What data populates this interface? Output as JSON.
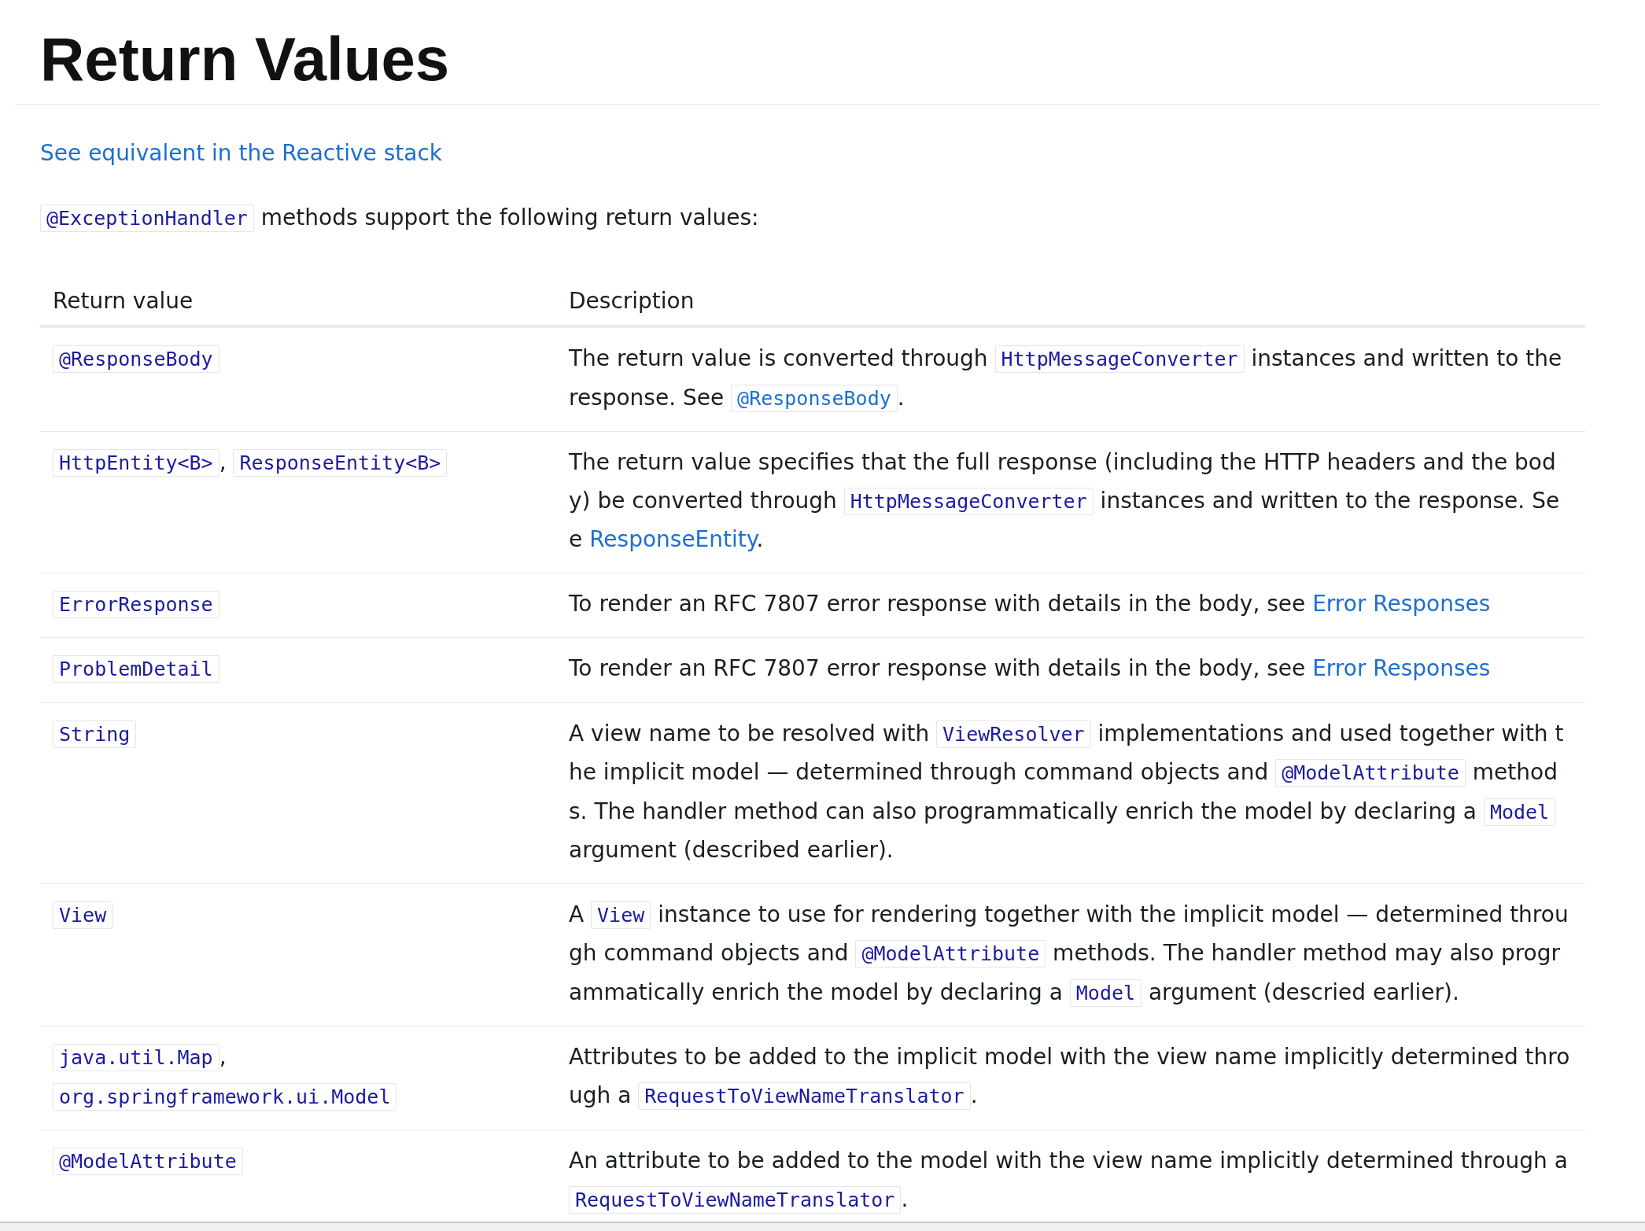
{
  "title": "Return Values",
  "reactive_link": "See equivalent in the Reactive stack",
  "intro": [
    {
      "kind": "code",
      "text": "@ExceptionHandler"
    },
    {
      "kind": "text",
      "text": " methods support the following return values:"
    }
  ],
  "table": {
    "columns": [
      "Return value",
      "Description"
    ],
    "rows": [
      {
        "return_value": [
          {
            "kind": "code",
            "text": "@ResponseBody"
          }
        ],
        "description": [
          {
            "kind": "text",
            "text": "The return value is converted through "
          },
          {
            "kind": "code",
            "text": "HttpMessageConverter"
          },
          {
            "kind": "text",
            "text": " instances and written to the response. See "
          },
          {
            "kind": "code_link",
            "text": "@ResponseBody"
          },
          {
            "kind": "text",
            "text": "."
          }
        ]
      },
      {
        "return_value": [
          {
            "kind": "code",
            "text": "HttpEntity<B>"
          },
          {
            "kind": "text",
            "text": ", "
          },
          {
            "kind": "code",
            "text": "ResponseEntity<B>"
          }
        ],
        "description": [
          {
            "kind": "text",
            "text": "The return value specifies that the full response (including the HTTP headers and the body) be converted through "
          },
          {
            "kind": "code",
            "text": "HttpMessageConverter"
          },
          {
            "kind": "text",
            "text": " instances and written to the response. See "
          },
          {
            "kind": "link",
            "text": "ResponseEntity"
          },
          {
            "kind": "text",
            "text": "."
          }
        ]
      },
      {
        "return_value": [
          {
            "kind": "code",
            "text": "ErrorResponse"
          }
        ],
        "description": [
          {
            "kind": "text",
            "text": "To render an RFC 7807 error response with details in the body, see "
          },
          {
            "kind": "link",
            "text": "Error Responses"
          }
        ]
      },
      {
        "return_value": [
          {
            "kind": "code",
            "text": "ProblemDetail"
          }
        ],
        "description": [
          {
            "kind": "text",
            "text": "To render an RFC 7807 error response with details in the body, see "
          },
          {
            "kind": "link",
            "text": "Error Responses"
          }
        ]
      },
      {
        "return_value": [
          {
            "kind": "code",
            "text": "String"
          }
        ],
        "description": [
          {
            "kind": "text",
            "text": "A view name to be resolved with "
          },
          {
            "kind": "code",
            "text": "ViewResolver"
          },
          {
            "kind": "text",
            "text": " implementations and used together with the implicit model — determined through command objects and "
          },
          {
            "kind": "code",
            "text": "@ModelAttribute"
          },
          {
            "kind": "text",
            "text": " methods. The handler method can also programmatically enrich the model by declaring a "
          },
          {
            "kind": "code",
            "text": "Model"
          },
          {
            "kind": "text",
            "text": " argument (described earlier)."
          }
        ]
      },
      {
        "return_value": [
          {
            "kind": "code",
            "text": "View"
          }
        ],
        "description": [
          {
            "kind": "text",
            "text": "A "
          },
          {
            "kind": "code",
            "text": "View"
          },
          {
            "kind": "text",
            "text": " instance to use for rendering together with the implicit model — determined through command objects and "
          },
          {
            "kind": "code",
            "text": "@ModelAttribute"
          },
          {
            "kind": "text",
            "text": " methods. The handler method may also programmatically enrich the model by declaring a "
          },
          {
            "kind": "code",
            "text": "Model"
          },
          {
            "kind": "text",
            "text": " argument (descried earlier)."
          }
        ]
      },
      {
        "return_value": [
          {
            "kind": "code",
            "text": "java.util.Map"
          },
          {
            "kind": "text",
            "text": ","
          },
          {
            "kind": "break"
          },
          {
            "kind": "code",
            "text": "org.springframework.ui.Model"
          }
        ],
        "description": [
          {
            "kind": "text",
            "text": "Attributes to be added to the implicit model with the view name implicitly determined through a "
          },
          {
            "kind": "code",
            "text": "RequestToViewNameTranslator"
          },
          {
            "kind": "text",
            "text": "."
          }
        ]
      },
      {
        "return_value": [
          {
            "kind": "code",
            "text": "@ModelAttribute"
          }
        ],
        "description": [
          {
            "kind": "text",
            "text": "An attribute to be added to the model with the view name implicitly determined through a "
          },
          {
            "kind": "code",
            "text": "RequestToViewNameTranslator"
          },
          {
            "kind": "text",
            "text": "."
          }
        ]
      }
    ]
  }
}
